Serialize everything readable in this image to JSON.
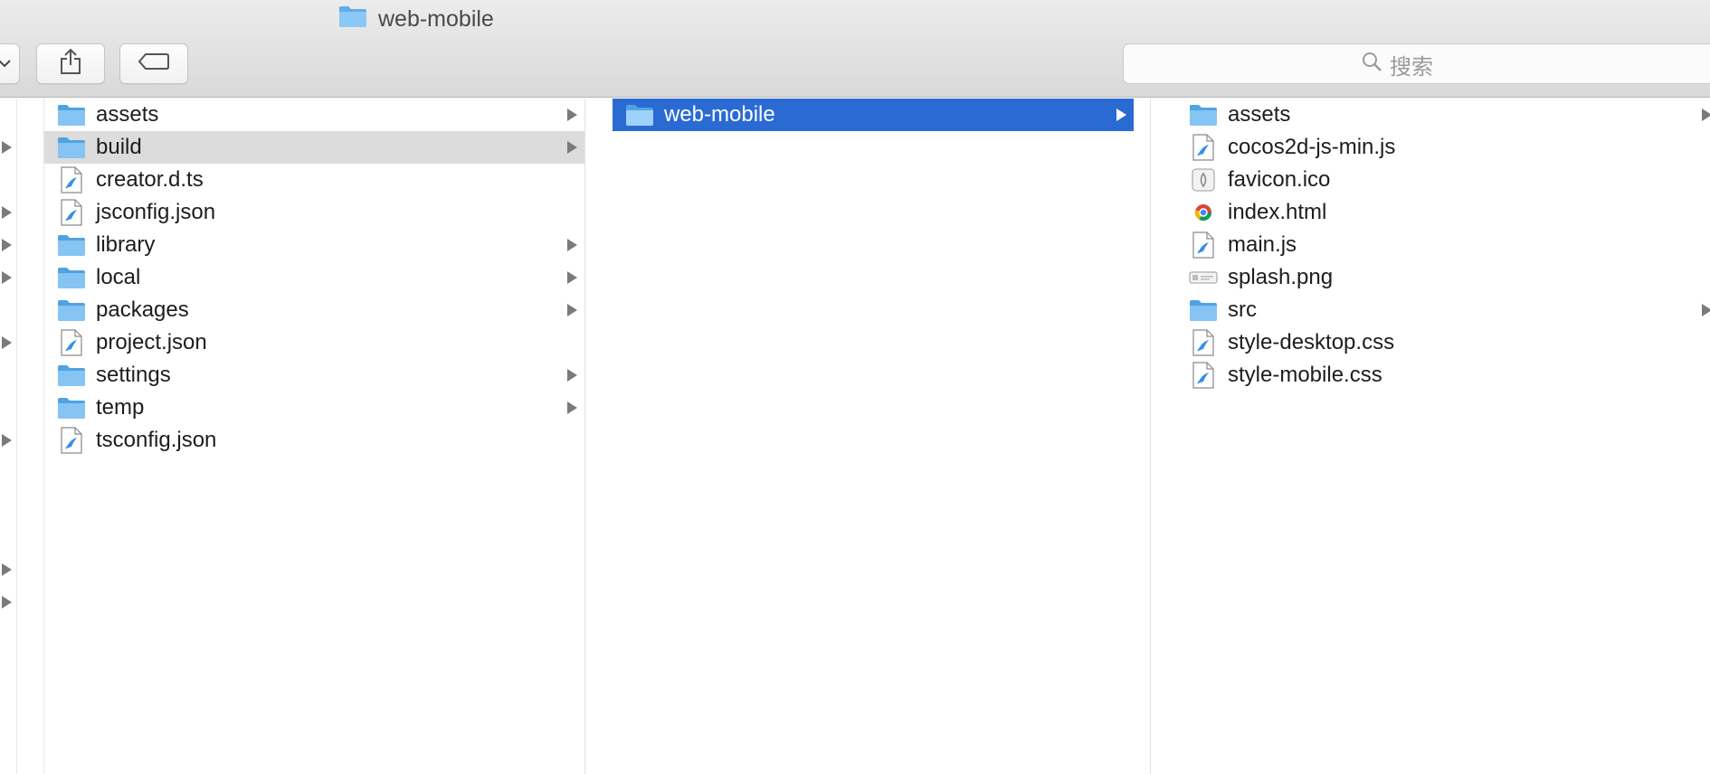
{
  "window": {
    "title": "web-mobile"
  },
  "toolbar": {
    "back_icon": "chevron-down-icon",
    "share_icon": "share-icon",
    "tag_icon": "tag-icon",
    "search_placeholder": "搜索"
  },
  "colors": {
    "folder": "#6cb4f0",
    "selection": "#2a6bd3",
    "highlight": "#dcdcdc"
  },
  "parent_column": {
    "items": [
      {
        "name": "assets",
        "type": "folder"
      },
      {
        "name": "build",
        "type": "folder"
      },
      {
        "name": "creator.d.ts",
        "type": "script"
      },
      {
        "name": "jsconfig.json",
        "type": "script"
      },
      {
        "name": "library",
        "type": "folder"
      },
      {
        "name": "local",
        "type": "folder"
      },
      {
        "name": "packages",
        "type": "folder"
      },
      {
        "name": "project.json",
        "type": "script"
      },
      {
        "name": "settings",
        "type": "folder"
      },
      {
        "name": "temp",
        "type": "folder"
      },
      {
        "name": "tsconfig.json",
        "type": "script"
      }
    ]
  },
  "build_column": {
    "items": [
      {
        "name": "web-mobile",
        "type": "folder"
      }
    ]
  },
  "web_mobile_column": {
    "items": [
      {
        "name": "assets",
        "type": "folder"
      },
      {
        "name": "cocos2d-js-min.js",
        "type": "script"
      },
      {
        "name": "favicon.ico",
        "type": "ico"
      },
      {
        "name": "index.html",
        "type": "html"
      },
      {
        "name": "main.js",
        "type": "script"
      },
      {
        "name": "splash.png",
        "type": "image"
      },
      {
        "name": "src",
        "type": "folder"
      },
      {
        "name": "style-desktop.css",
        "type": "script"
      },
      {
        "name": "style-mobile.css",
        "type": "script"
      }
    ]
  }
}
